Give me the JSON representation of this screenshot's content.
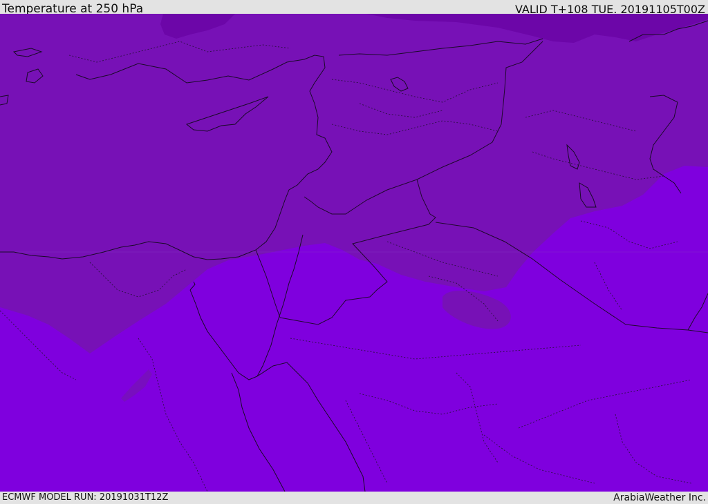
{
  "header": {
    "title": "Temperature at 250 hPa",
    "valid_time": "VALID T+108 TUE. 20191105T00Z"
  },
  "footer": {
    "model_run": "ECMWF MODEL RUN: 20191031T12Z",
    "credit": "ArabiaWeather Inc."
  },
  "colors": {
    "warm_band": "#7f00de",
    "mid_band": "#7711b6",
    "cold_band": "#6c06a8",
    "coastline": "#1a0a28",
    "border": "#2a1040"
  }
}
